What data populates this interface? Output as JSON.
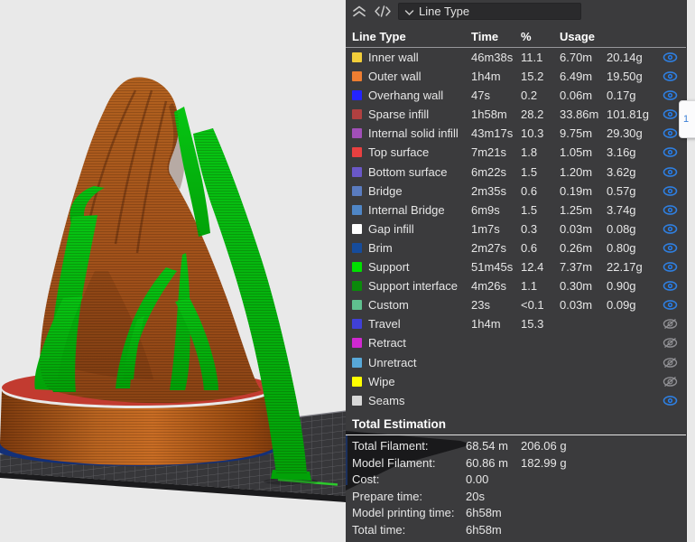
{
  "header": {
    "collapse_icon": "chevron-double-up",
    "code_icon": "code-brackets",
    "dropdown": {
      "icon": "chevron-down",
      "selected": "Line Type"
    }
  },
  "table": {
    "columns": {
      "type": "Line Type",
      "time": "Time",
      "pct": "%",
      "usage": "Usage"
    },
    "rows": [
      {
        "label": "Inner wall",
        "color": "#f2ce3a",
        "time": "46m38s",
        "pct": "11.1",
        "length": "6.70m",
        "weight": "20.14g",
        "visible": true
      },
      {
        "label": "Outer wall",
        "color": "#ee7e31",
        "time": "1h4m",
        "pct": "15.2",
        "length": "6.49m",
        "weight": "19.50g",
        "visible": true
      },
      {
        "label": "Overhang wall",
        "color": "#2424ff",
        "time": "47s",
        "pct": "0.2",
        "length": "0.06m",
        "weight": "0.17g",
        "visible": true
      },
      {
        "label": "Sparse infill",
        "color": "#b04040",
        "time": "1h58m",
        "pct": "28.2",
        "length": "33.86m",
        "weight": "101.81g",
        "visible": true
      },
      {
        "label": "Internal solid infill",
        "color": "#a14fb8",
        "time": "43m17s",
        "pct": "10.3",
        "length": "9.75m",
        "weight": "29.30g",
        "visible": true
      },
      {
        "label": "Top surface",
        "color": "#e84040",
        "time": "7m21s",
        "pct": "1.8",
        "length": "1.05m",
        "weight": "3.16g",
        "visible": true
      },
      {
        "label": "Bottom surface",
        "color": "#6a58c8",
        "time": "6m22s",
        "pct": "1.5",
        "length": "1.20m",
        "weight": "3.62g",
        "visible": true
      },
      {
        "label": "Bridge",
        "color": "#5a7cc0",
        "time": "2m35s",
        "pct": "0.6",
        "length": "0.19m",
        "weight": "0.57g",
        "visible": true
      },
      {
        "label": "Internal Bridge",
        "color": "#4f86c6",
        "time": "6m9s",
        "pct": "1.5",
        "length": "1.25m",
        "weight": "3.74g",
        "visible": true
      },
      {
        "label": "Gap infill",
        "color": "#ffffff",
        "time": "1m7s",
        "pct": "0.3",
        "length": "0.03m",
        "weight": "0.08g",
        "visible": true
      },
      {
        "label": "Brim",
        "color": "#164c9c",
        "time": "2m27s",
        "pct": "0.6",
        "length": "0.26m",
        "weight": "0.80g",
        "visible": true
      },
      {
        "label": "Support",
        "color": "#00e000",
        "time": "51m45s",
        "pct": "12.4",
        "length": "7.37m",
        "weight": "22.17g",
        "visible": true
      },
      {
        "label": "Support interface",
        "color": "#0a8a0a",
        "time": "4m26s",
        "pct": "1.1",
        "length": "0.30m",
        "weight": "0.90g",
        "visible": true
      },
      {
        "label": "Custom",
        "color": "#5fc08f",
        "time": "23s",
        "pct": "<0.1",
        "length": "0.03m",
        "weight": "0.09g",
        "visible": true
      },
      {
        "label": "Travel",
        "color": "#4040d8",
        "time": "1h4m",
        "pct": "15.3",
        "length": "",
        "weight": "",
        "visible": false
      },
      {
        "label": "Retract",
        "color": "#d028d0",
        "time": "",
        "pct": "",
        "length": "",
        "weight": "",
        "visible": false
      },
      {
        "label": "Unretract",
        "color": "#58a8d8",
        "time": "",
        "pct": "",
        "length": "",
        "weight": "",
        "visible": false
      },
      {
        "label": "Wipe",
        "color": "#ffff00",
        "time": "",
        "pct": "",
        "length": "",
        "weight": "",
        "visible": false
      },
      {
        "label": "Seams",
        "color": "#d8d8d8",
        "time": "",
        "pct": "",
        "length": "",
        "weight": "",
        "visible": true
      }
    ]
  },
  "totals": {
    "title": "Total Estimation",
    "rows": [
      {
        "label": "Total Filament:",
        "value": "68.54 m",
        "value2": "206.06 g"
      },
      {
        "label": "Model Filament:",
        "value": "60.86 m",
        "value2": "182.99 g"
      },
      {
        "label": "Cost:",
        "value": "0.00",
        "value2": ""
      },
      {
        "label": "Prepare time:",
        "value": "20s",
        "value2": ""
      },
      {
        "label": "Model printing time:",
        "value": "6h58m",
        "value2": ""
      },
      {
        "label": "Total time:",
        "value": "6h58m",
        "value2": ""
      }
    ]
  },
  "layer_badge": {
    "text": "1"
  },
  "scene": {
    "colors": {
      "background": "#e9e9e9",
      "model": "#ad5a1f",
      "model_dark": "#8a4314",
      "support": "#03b80d",
      "support_dark": "#019a06",
      "base_top": "#c23b30",
      "brim": "#133078",
      "plate": "#37373a",
      "plate_grid": "#5d5d61",
      "plate_edge_green": "#2cc92c",
      "eye_on": "#2f7fe0",
      "eye_off": "#8f8f93"
    }
  }
}
